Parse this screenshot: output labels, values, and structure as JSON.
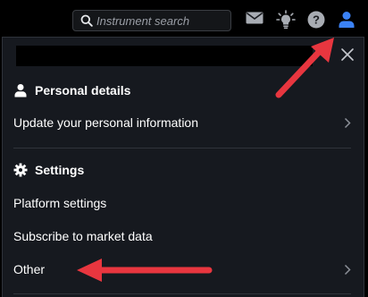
{
  "topbar": {
    "search": {
      "placeholder": "Instrument search",
      "value": ""
    },
    "icons": [
      "search-icon",
      "mail-icon",
      "lightbulb-icon",
      "help-icon",
      "user-icon"
    ]
  },
  "menu": {
    "personal_details": {
      "title": "Personal details",
      "icon": "person-icon",
      "items": [
        {
          "label": "Update your personal information",
          "chevron": true
        }
      ]
    },
    "settings": {
      "title": "Settings",
      "icon": "gear-icon",
      "items": [
        {
          "label": "Platform settings",
          "chevron": false
        },
        {
          "label": "Subscribe to market data",
          "chevron": false
        },
        {
          "label": "Other",
          "chevron": true
        }
      ]
    }
  },
  "colors": {
    "background": "#000000",
    "panel": "#16191f",
    "user_icon": "#3b82f6",
    "annotation_arrow": "#e8363f",
    "text": "#ffffff"
  }
}
